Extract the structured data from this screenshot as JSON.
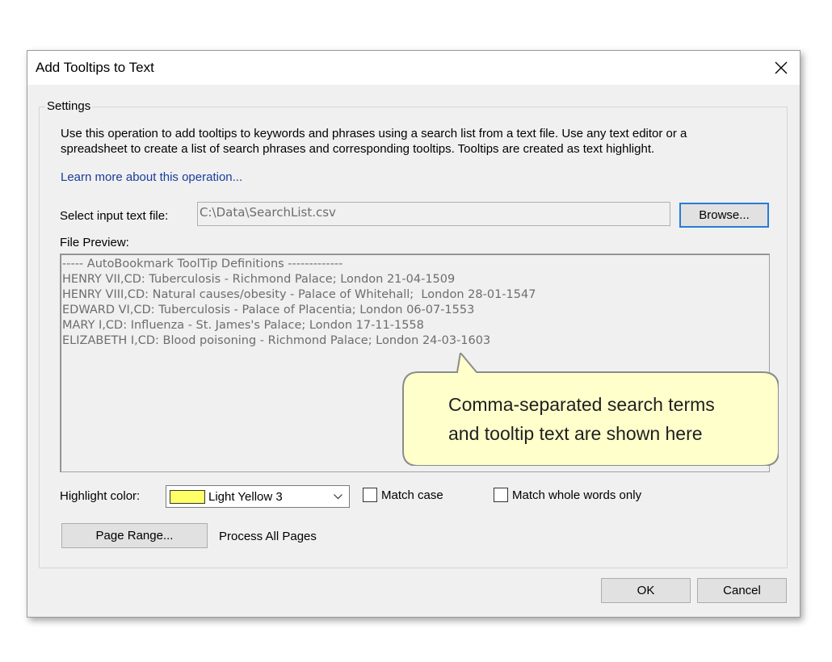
{
  "dialog": {
    "title": "Add Tooltips to Text",
    "close_icon": "close-icon"
  },
  "settings": {
    "legend": "Settings",
    "description": "Use this operation to add tooltips to keywords and phrases using a search list from a text file. Use any text editor or a spreadsheet to create a list of search phrases and corresponding tooltips. Tooltips are created as text highlight.",
    "learn_more": "Learn more about this operation...",
    "input_label": "Select input text file:",
    "input_value": "C:\\Data\\SearchList.csv",
    "browse_label": "Browse...",
    "preview_label": "File Preview:",
    "preview_lines": [
      "----- AutoBookmark ToolTip Definitions -------------",
      "HENRY VII,CD: Tuberculosis - Richmond Palace; London 21-04-1509",
      "HENRY VIII,CD: Natural causes/obesity - Palace of Whitehall;  London 28-01-1547",
      "EDWARD VI,CD: Tuberculosis - Palace of Placentia; London 06-07-1553",
      "MARY I,CD: Influenza - St. James's Palace; London 17-11-1558",
      "ELIZABETH I,CD: Blood poisoning - Richmond Palace; London 24-03-1603"
    ],
    "callout_line1": "Comma-separated search terms",
    "callout_line2": "and tooltip text are shown here",
    "highlight_label": "Highlight color:",
    "highlight_value": "Light Yellow 3",
    "highlight_swatch_color": "#ffff66",
    "match_case_label": "Match case",
    "match_case_checked": false,
    "match_whole_label": "Match whole words only",
    "match_whole_checked": false,
    "page_range_label": "Page Range...",
    "page_range_status": "Process All Pages"
  },
  "footer": {
    "ok_label": "OK",
    "cancel_label": "Cancel"
  },
  "colors": {
    "callout_fill": "#ffffcc",
    "callout_border": "#8c8c8c",
    "link": "#1a3c9c",
    "focus_border": "#2a7ad4"
  }
}
